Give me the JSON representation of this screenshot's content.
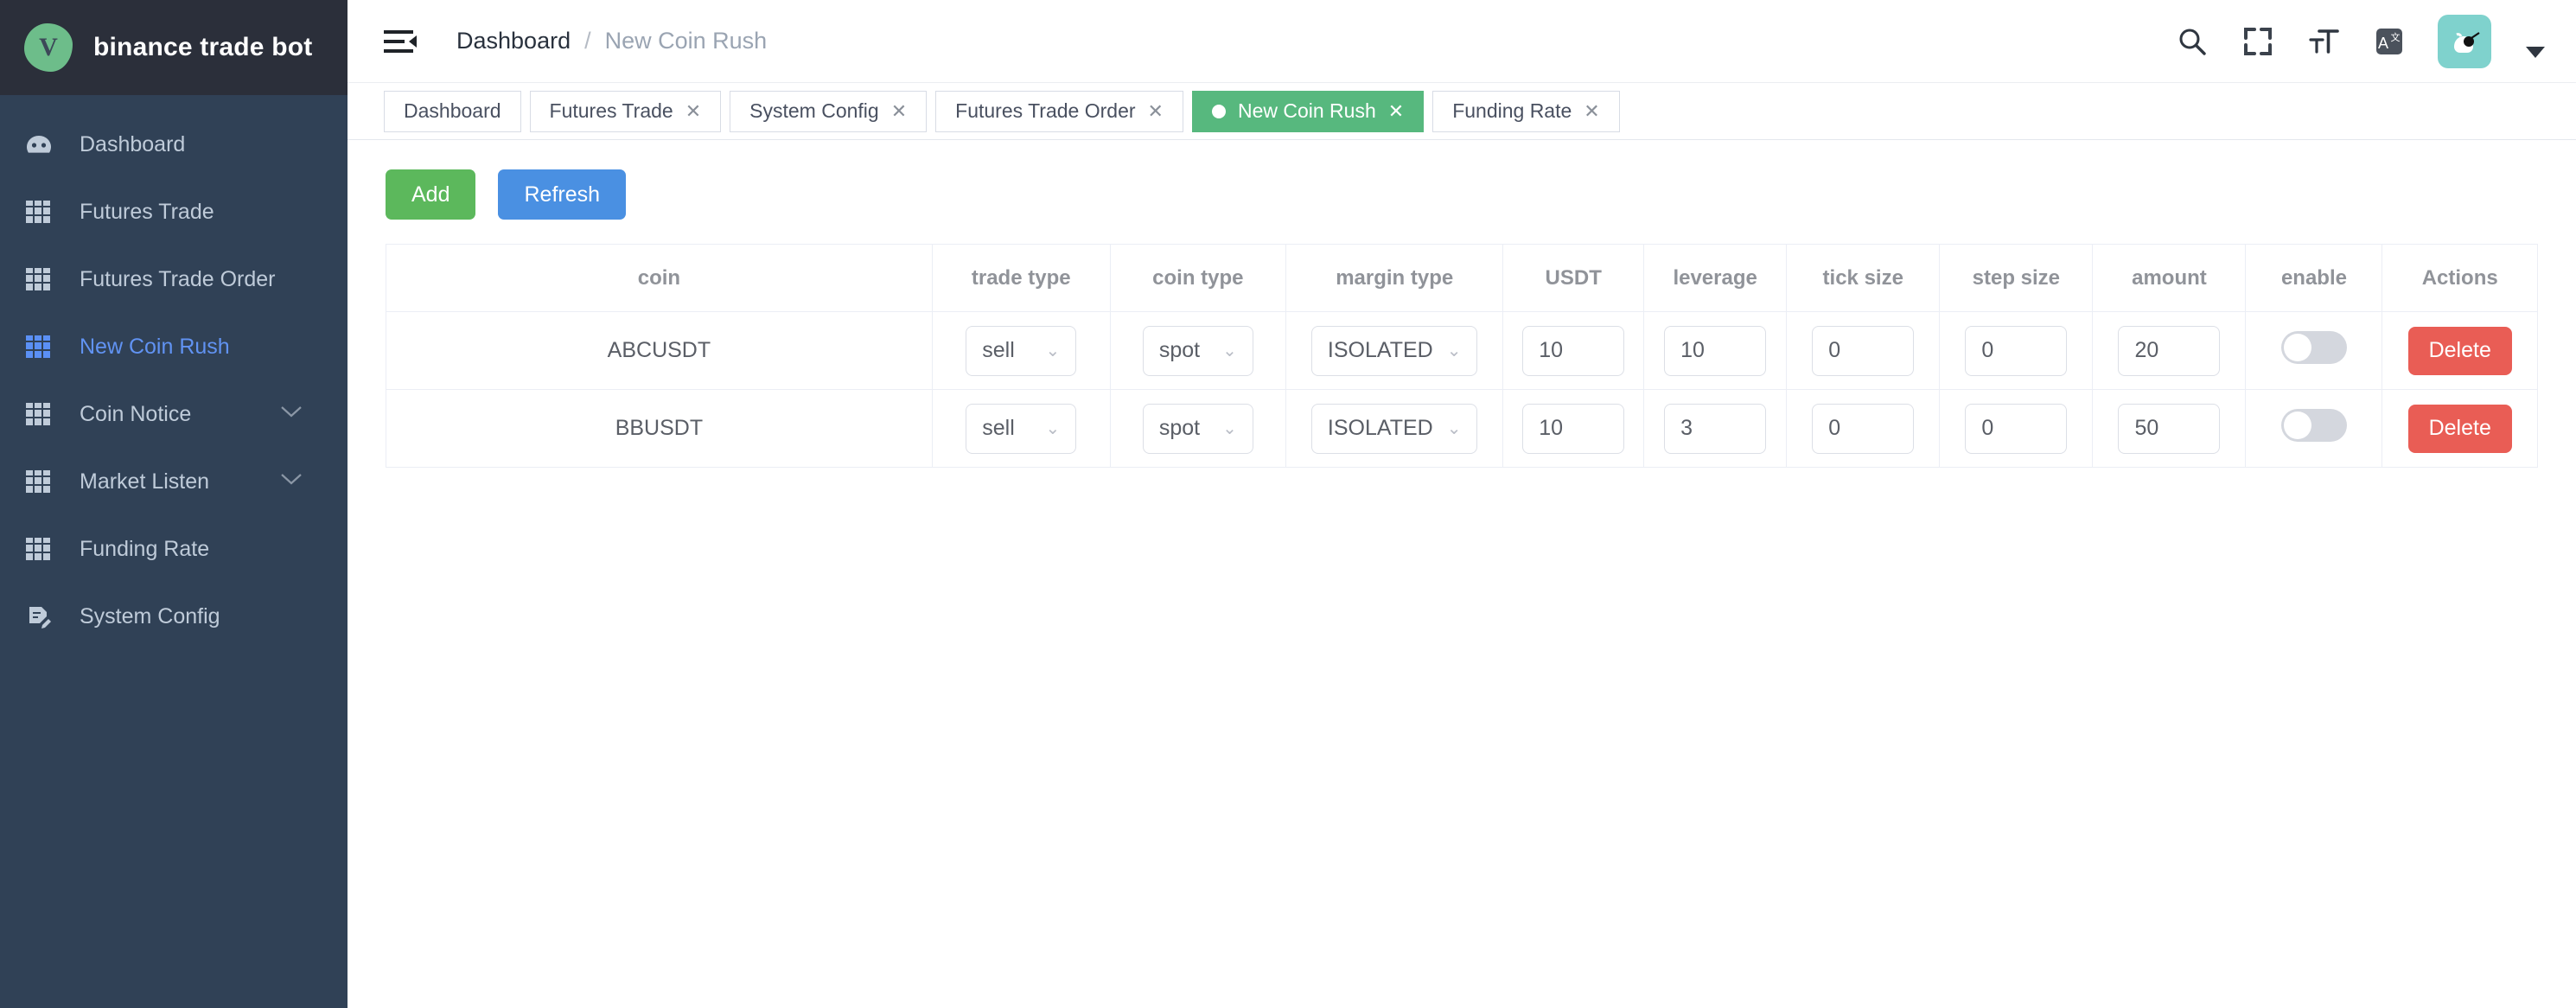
{
  "brand": {
    "logo_letter": "V",
    "title": "binance trade bot",
    "logo_color": "#6dbd8a"
  },
  "sidebar": {
    "items": [
      {
        "label": "Dashboard",
        "icon": "dashboard-icon",
        "active": false,
        "expandable": false
      },
      {
        "label": "Futures Trade",
        "icon": "table-icon",
        "active": false,
        "expandable": false
      },
      {
        "label": "Futures Trade Order",
        "icon": "table-icon",
        "active": false,
        "expandable": false
      },
      {
        "label": "New Coin Rush",
        "icon": "table-icon",
        "active": true,
        "expandable": false
      },
      {
        "label": "Coin Notice",
        "icon": "table-icon",
        "active": false,
        "expandable": true
      },
      {
        "label": "Market Listen",
        "icon": "table-icon",
        "active": false,
        "expandable": true
      },
      {
        "label": "Funding Rate",
        "icon": "table-icon",
        "active": false,
        "expandable": false
      },
      {
        "label": "System Config",
        "icon": "document-edit-icon",
        "active": false,
        "expandable": false
      }
    ]
  },
  "topbar": {
    "menu_toggle_icon": "hamburger-collapse-icon",
    "breadcrumb": {
      "root": "Dashboard",
      "separator": "/",
      "current": "New Coin Rush"
    },
    "actions": [
      {
        "icon": "search-icon"
      },
      {
        "icon": "fullscreen-icon"
      },
      {
        "icon": "font-size-icon"
      },
      {
        "icon": "translate-icon"
      }
    ],
    "avatar": {
      "icon": "avatar-icon",
      "color": "#7fd2cd"
    },
    "caret": "chevron-down-icon"
  },
  "tabs": [
    {
      "label": "Dashboard",
      "active": false,
      "closable": false
    },
    {
      "label": "Futures Trade",
      "active": false,
      "closable": true
    },
    {
      "label": "System Config",
      "active": false,
      "closable": true
    },
    {
      "label": "Futures Trade Order",
      "active": false,
      "closable": true
    },
    {
      "label": "New Coin Rush",
      "active": true,
      "closable": true
    },
    {
      "label": "Funding Rate",
      "active": false,
      "closable": true
    }
  ],
  "toolbar": {
    "add_label": "Add",
    "refresh_label": "Refresh",
    "add_color": "#5cb85c",
    "refresh_color": "#4a90e2"
  },
  "table": {
    "columns": [
      "coin",
      "trade type",
      "coin type",
      "margin type",
      "USDT",
      "leverage",
      "tick size",
      "step size",
      "amount",
      "enable",
      "Actions"
    ],
    "rows": [
      {
        "coin": "ABCUSDT",
        "trade_type": "sell",
        "coin_type": "spot",
        "margin_type": "ISOLATED",
        "usdt": "10",
        "leverage": "10",
        "tick_size": "0",
        "step_size": "0",
        "amount": "20",
        "enable": false,
        "action_label": "Delete"
      },
      {
        "coin": "BBUSDT",
        "trade_type": "sell",
        "coin_type": "spot",
        "margin_type": "ISOLATED",
        "usdt": "10",
        "leverage": "3",
        "tick_size": "0",
        "step_size": "0",
        "amount": "50",
        "enable": false,
        "action_label": "Delete"
      }
    ],
    "delete_color": "#e95d55"
  }
}
